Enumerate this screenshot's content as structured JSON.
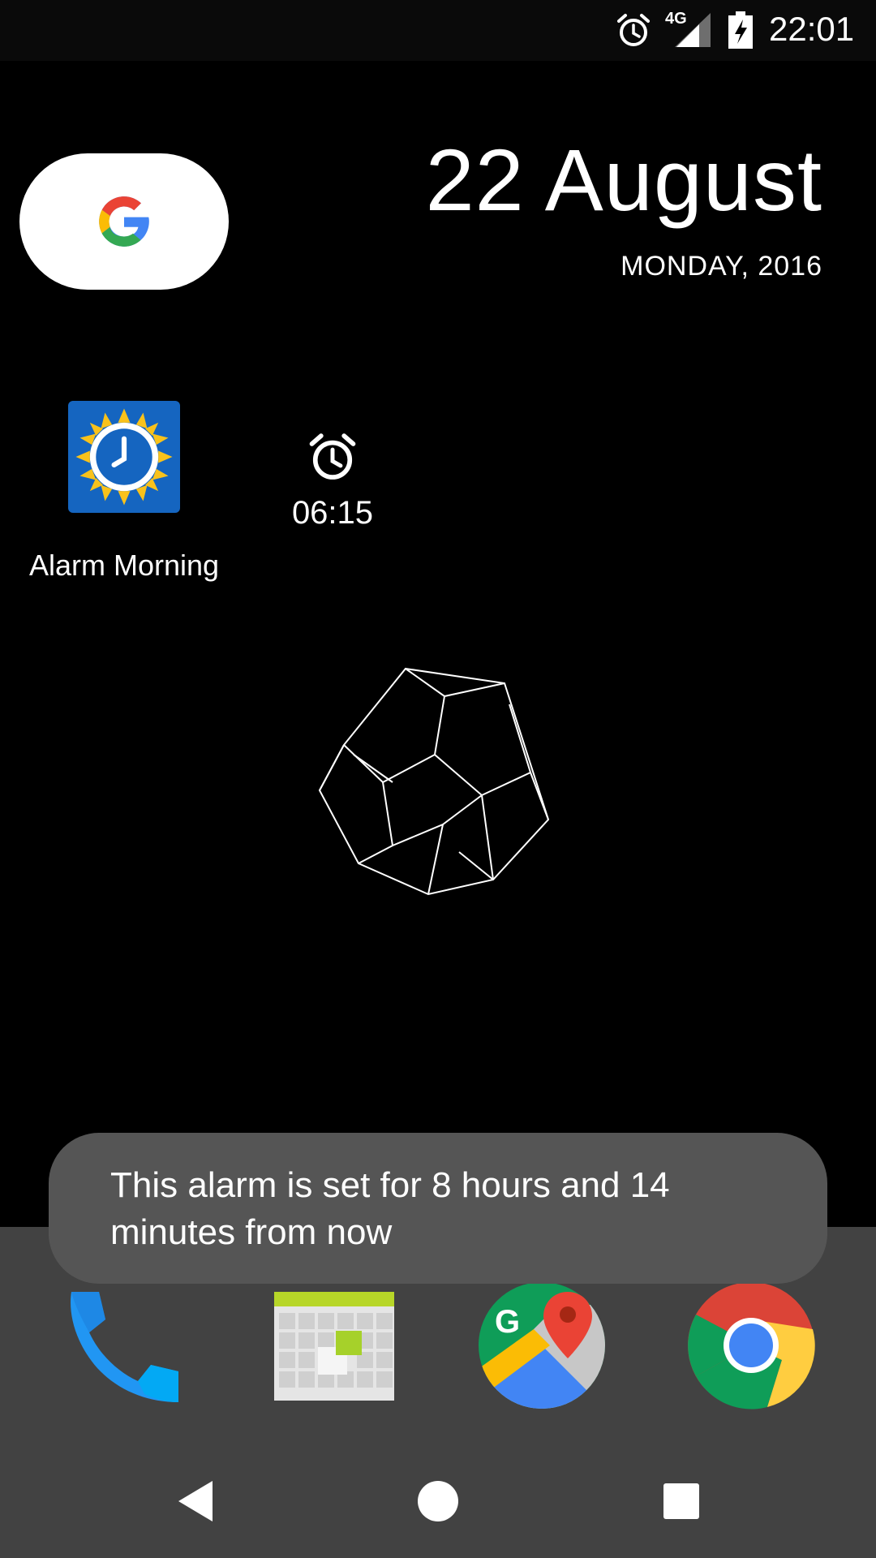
{
  "status_bar": {
    "network": "4G",
    "time": "22:01"
  },
  "date_widget": {
    "date": "22 August",
    "weekday_year": "MONDAY, 2016"
  },
  "apps": {
    "alarm_morning": {
      "label": "Alarm Morning"
    }
  },
  "alarm_widget": {
    "time": "06:15"
  },
  "toast": {
    "message": "This alarm is set for 8 hours and 14 minutes from now"
  },
  "dock": {
    "items": [
      "phone-icon",
      "calendar-icon",
      "maps-icon",
      "chrome-icon"
    ]
  },
  "colors": {
    "dock_bg": "#424242",
    "toast_bg": "#555555",
    "alarm_app_blue": "#1565c0",
    "google_blue": "#4285F4",
    "google_red": "#EA4335",
    "google_yellow": "#FBBC05",
    "google_green": "#34A853"
  }
}
